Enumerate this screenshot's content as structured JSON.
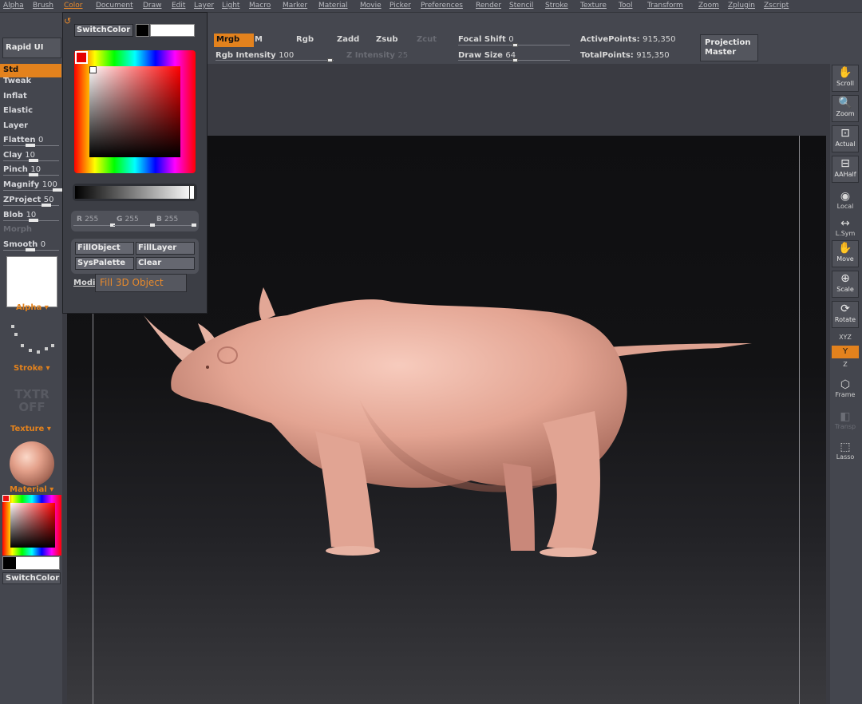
{
  "menu": [
    "Alpha",
    "Brush",
    "Color",
    "Document",
    "Draw",
    "Edit",
    "Layer",
    "Light",
    "Macro",
    "Marker",
    "Material",
    "Movie",
    "Picker",
    "Preferences",
    "Render",
    "Stencil",
    "Stroke",
    "Texture",
    "Tool",
    "Transform",
    "Zoom",
    "Zplugin",
    "Zscript"
  ],
  "menu_active": "Color",
  "toolbar": {
    "rapid_ui": "Rapid UI",
    "mrgb": "Mrgb",
    "m": "M",
    "rgb": "Rgb",
    "zadd": "Zadd",
    "zsub": "Zsub",
    "zcut": "Zcut",
    "rgb_intensity_label": "Rgb Intensity",
    "rgb_intensity_value": "100",
    "z_intensity_label": "Z Intensity",
    "z_intensity_value": "25",
    "focal_shift_label": "Focal Shift",
    "focal_shift_value": "0",
    "draw_size_label": "Draw Size",
    "draw_size_value": "64",
    "active_points_label": "ActivePoints:",
    "active_points_value": "915,350",
    "total_points_label": "TotalPoints:",
    "total_points_value": "915,350",
    "projection_master_1": "Projection",
    "projection_master_2": "Master"
  },
  "left_shelf": {
    "std": "Std",
    "tweak": "Tweak",
    "inflat": "Inflat",
    "elastic": "Elastic",
    "layer": "Layer",
    "flatten_label": "Flatten",
    "flatten_value": "0",
    "clay_label": "Clay",
    "clay_value": "10",
    "pinch_label": "Pinch",
    "pinch_value": "10",
    "magnify_label": "Magnify",
    "magnify_value": "100",
    "zproject_label": "ZProject",
    "zproject_value": "50",
    "blob_label": "Blob",
    "blob_value": "10",
    "morph": "Morph",
    "smooth_label": "Smooth",
    "smooth_value": "0",
    "alpha": "Alpha",
    "stroke": "Stroke",
    "txtr_1": "TXTR",
    "txtr_2": "OFF",
    "texture": "Texture",
    "material": "Material",
    "switch_color": "SwitchColor"
  },
  "right_shelf": {
    "scroll": "Scroll",
    "zoom": "Zoom",
    "actual": "Actual",
    "aahalf": "AAHalf",
    "local": "Local",
    "lsym": "L.Sym",
    "move": "Move",
    "scale": "Scale",
    "rotate": "Rotate",
    "xyz": "XYZ",
    "y": "Y",
    "z": "Z",
    "frame": "Frame",
    "transp": "Transp",
    "lasso": "Lasso"
  },
  "color_palette": {
    "switch_color": "SwitchColor",
    "r_label": "R",
    "r_value": "255",
    "g_label": "G",
    "g_value": "255",
    "b_label": "B",
    "b_value": "255",
    "fill_object": "FillObject",
    "fill_layer": "FillLayer",
    "sys_palette": "SysPalette",
    "clear": "Clear",
    "modifiers": "Modif",
    "tooltip": "Fill 3D Object"
  },
  "colors": {
    "accent": "#e3821d",
    "model_skin": "#e8aa98",
    "panel_bg": "#44464e"
  }
}
